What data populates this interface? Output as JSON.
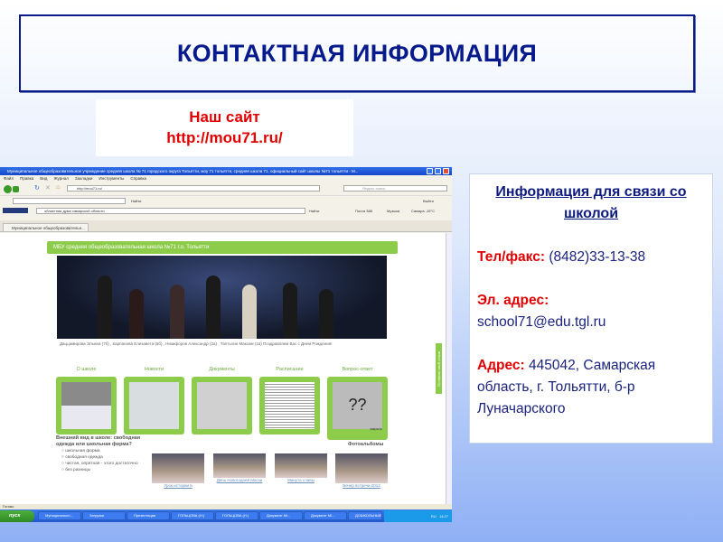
{
  "slide": {
    "title": "КОНТАКТНАЯ ИНФОРМАЦИЯ",
    "site_label": "Наш сайт",
    "site_url": "http://mou71.ru/",
    "info": {
      "heading": "Информация для связи со школой",
      "phone_label": "Тел/факс:",
      "phone": "(8482)33-13-38",
      "email_label": "Эл. адрес:",
      "email": "school71@edu.tgl.ru",
      "address_label": "Адрес:",
      "address": "445042, Самарская область, г. Тольятти, б-р Луначарского"
    }
  },
  "browser": {
    "window_title": "Муниципальное общеобразовательное учреждение средняя школа № 71 городского округа Тольятти, моу 71 тольятти, средняя школа 71, официальный сайт школы №71 тольятти - M...",
    "menu": [
      "Файл",
      "Правка",
      "Вид",
      "Журнал",
      "Закладки",
      "Инструменты",
      "Справка"
    ],
    "address": "http://mou71.ru/",
    "search_placeholder": "Яндекс поиск",
    "toolbar_find": "Найти",
    "toolbar_exit": "Выйти",
    "toolbar3_query": "областная дума самарской области",
    "toolbar3_items": [
      "Найти",
      "Почта 388",
      "Музыка",
      "Самара -15°C"
    ],
    "tab": "Муниципальное общеобразовательн...",
    "status": "Готово",
    "page": {
      "header": "МБУ средняя общеобразовательная школа №71 г.о. Тольятти",
      "caption": "Даццамирова Эльина (7б) , Карпанова Елизавета (6б) , Никифоров Александр (2а) , Таптыгин Максим (1в) Поздравляем Вас с Днем Рождения!",
      "categories": [
        "О школе",
        "Новости",
        "Документы",
        "Расписание",
        "Вопрос-ответ"
      ],
      "close_link": "закрыть",
      "poll_question": "Внешний вид в школе: свободная одежда или школьная форма?",
      "poll_options": [
        "школьная форма",
        "свободная одежда",
        "чистая, опрятная - этого достаточно",
        "без разницы"
      ],
      "albums_title": "Фотоальбомы",
      "albums": [
        "Урок истории в",
        "День Новогодней Маски",
        "Минута славы",
        "Вечер встречи 2012"
      ],
      "side_tab": "Оставить свой отзыв"
    },
    "taskbar": {
      "start": "пуск",
      "items": [
        "Муниципально...",
        "Загрузки",
        "Презентации",
        "ГОЛЬЦОВА (H:)",
        "ГОЛЬЦОВА (H:)",
        "Документ Mi...",
        "Документ Mi...",
        "ДОШКОЛЬНЫЕ..."
      ],
      "lang": "RU",
      "clock": "14:27"
    }
  }
}
